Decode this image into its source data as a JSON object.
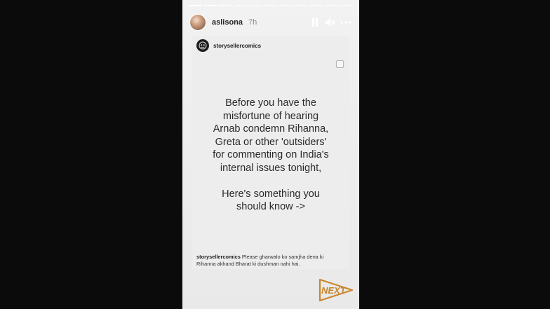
{
  "story": {
    "progress": [
      1,
      1,
      0.4,
      0,
      0,
      0,
      0,
      0,
      0,
      0,
      0
    ],
    "username": "aslisona",
    "time_ago": "7h",
    "icons": {
      "pause": "pause-icon",
      "mute": "mute-icon",
      "more": "more-options-icon",
      "bookmark": "bookmark-icon"
    }
  },
  "post": {
    "username": "storysellercomics",
    "main_text_paragraph1": "Before you have the\nmisfortune of hearing\nArnab condemn Rihanna,\nGreta or other 'outsiders'\nfor commenting on India's\ninternal issues tonight,",
    "main_text_paragraph2": "Here's something you\nshould know ->",
    "caption_user": "storysellercomics",
    "caption_text": "Please gharwalo ko samjha dena ki Rihanna akhand Bharat ki dushman nahi hai."
  },
  "watermark": {
    "text": "NEXT",
    "color": "#c9862d"
  },
  "colors": {
    "background": "#0b0b0b",
    "story_bg": "#ededed",
    "text": "#2a2a2a"
  }
}
